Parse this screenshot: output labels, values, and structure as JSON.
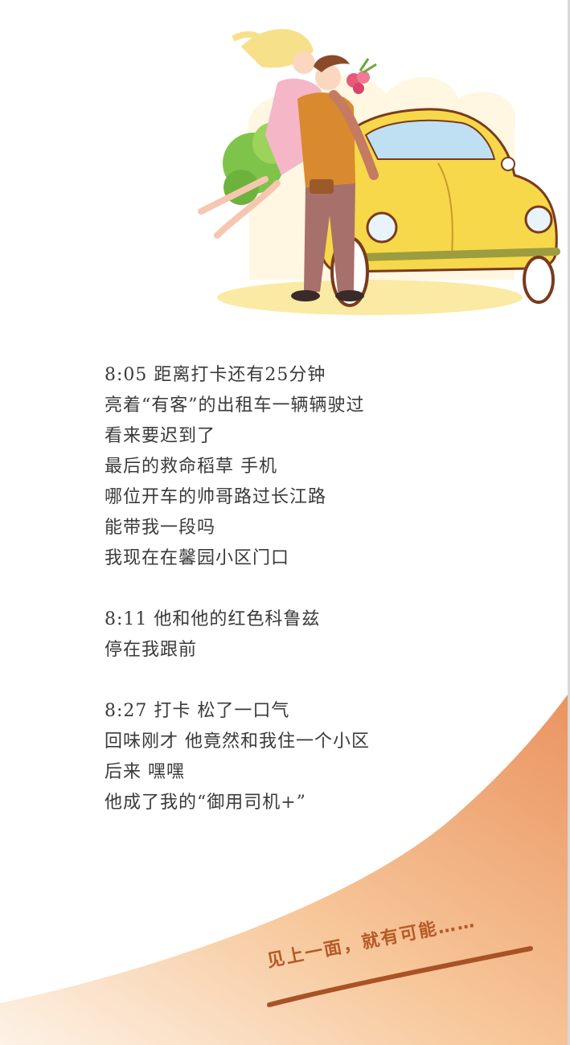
{
  "story": {
    "lines": [
      "8:05 距离打卡还有25分钟",
      "亮着“有客”的出租车一辆辆驶过",
      "看来要迟到了",
      "最后的救命稻草  手机",
      "哪位开车的帅哥路过长江路",
      "能带我一段吗",
      "我现在在馨园小区门口",
      "",
      "8:11 他和他的红色科鲁兹",
      "停在我跟前",
      "",
      "8:27  打卡  松了一口气",
      "回味刚才  他竟然和我住一个小区",
      "后来  嘿嘿",
      "他成了我的“御用司机+”"
    ]
  },
  "slogan": "见上一面，就有可能……",
  "colors": {
    "text": "#3a3a3a",
    "wave_light": "#fbe3cc",
    "wave_dark": "#ec9a66",
    "slogan": "#b65a28",
    "car_yellow": "#f6d84a"
  }
}
